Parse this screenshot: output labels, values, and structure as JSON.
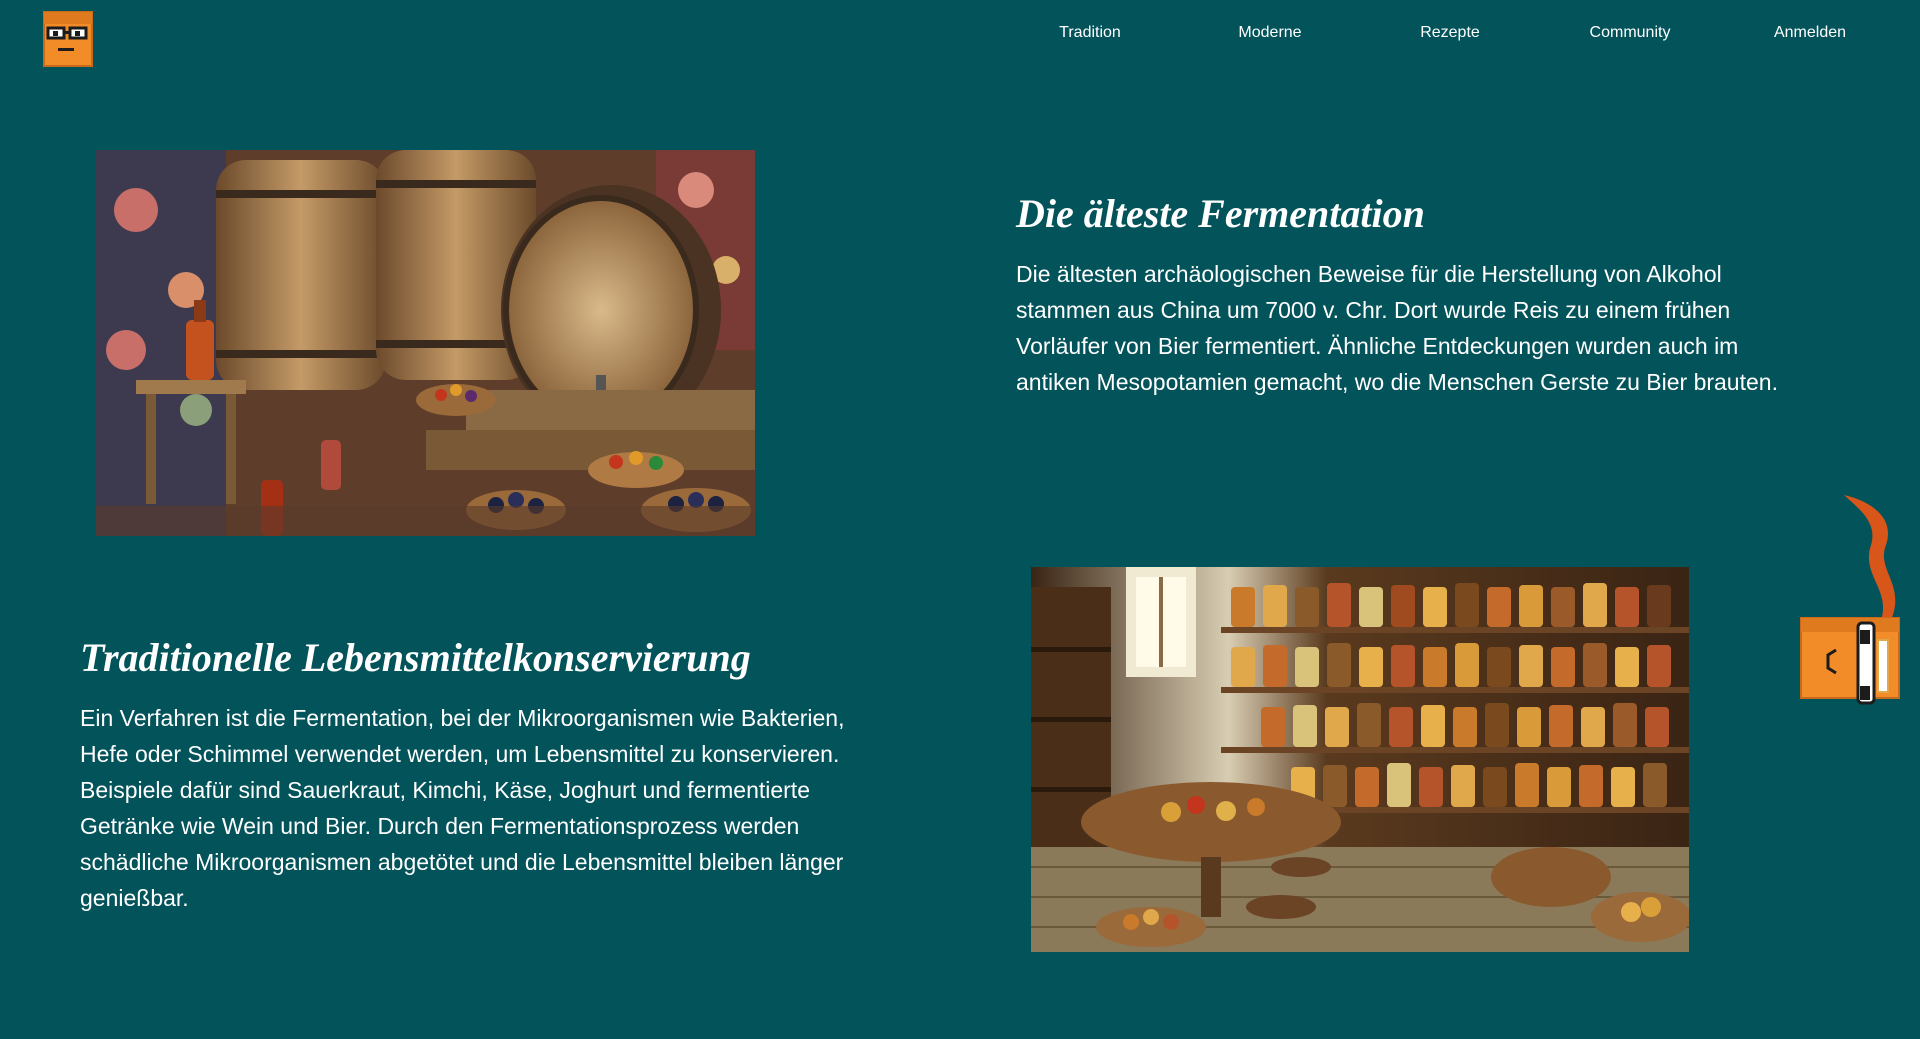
{
  "nav": {
    "items": [
      {
        "label": "Tradition"
      },
      {
        "label": "Moderne"
      },
      {
        "label": "Rezepte"
      },
      {
        "label": "Community"
      },
      {
        "label": "Anmelden"
      }
    ]
  },
  "section1": {
    "title": "Die älteste Fermentation",
    "text": "Die ältesten archäologischen Beweise für die Herstellung von Alkohol stammen aus China um 7000 v. Chr. Dort wurde Reis zu einem frühen Vorläufer von Bier fermentiert. Ähnliche Entdeckungen wurden auch im antiken Mesopotamien gemacht, wo die Menschen Gerste zu Bier brauten.",
    "image_alt": "Holzfässer und Fermentationsgefäße"
  },
  "section2": {
    "title": "Traditionelle Lebensmittelkonservierung",
    "text": "Ein Verfahren ist die Fermentation, bei der Mikroorganismen wie Bakterien, Hefe oder Schimmel verwendet werden, um Lebensmittel zu konservieren. Beispiele dafür sind Sauerkraut, Kimchi, Käse, Joghurt und fermentierte Getränke wie Wein und Bier. Durch den Fermentationsprozess werden schädliche Mikroorganismen abgetötet und die Lebensmittel bleiben länger genießbar.",
    "image_alt": "Vorratskammer mit Einmachgläsern"
  },
  "colors": {
    "background": "#03535b",
    "accent": "#f28c28",
    "flame": "#d9561a",
    "text": "#ffffff"
  }
}
